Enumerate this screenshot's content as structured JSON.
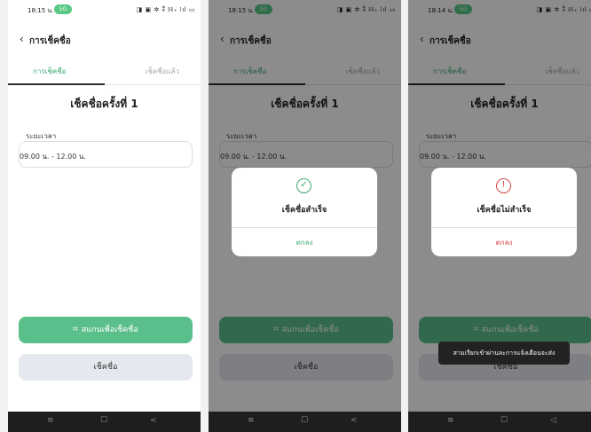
{
  "screens": [
    {
      "status": {
        "time": "18:15 น.",
        "badge": "5G",
        "sys": "◨ ▣ ✲ ⁑ ℍ₊ ⁞ıl ▭"
      },
      "title": "การเช็คชื่อ",
      "tabs": [
        {
          "label": "การเช็คชื่อ"
        },
        {
          "label": "เช็คชื่อแล้ว"
        }
      ],
      "heading": "เช็คชื่อครั้งที่ 1",
      "field_label": "ระยะเวลา",
      "field_value": "09.00 น. - 12.00 น.",
      "scan_button": "สแกนเพื่อเช็คชื่อ",
      "check_button": "เช็คชื่อ",
      "nav": [
        "≡",
        "☐",
        "<"
      ]
    },
    {
      "status": {
        "time": "18:15 น.",
        "badge": "5G",
        "sys": "◨ ▣ ✲ ⁑ ℍ₊ ⁞ıl ▭"
      },
      "title": "การเช็คชื่อ",
      "tabs": [
        {
          "label": "การเช็คชื่อ"
        },
        {
          "label": "เช็คชื่อแล้ว"
        }
      ],
      "heading": "เช็คชื่อครั้งที่ 1",
      "field_label": "ระยะเวลา",
      "field_value": "09.00 น. - 12.00 น.",
      "scan_button": "สแกนเพื่อเช็คชื่อ",
      "check_button": "เช็คชื่อ",
      "nav": [
        "≡",
        "☐",
        "<"
      ],
      "dialog": {
        "icon": "✓",
        "message": "เช็คชื่อสำเร็จ",
        "button": "ตกลง"
      }
    },
    {
      "status": {
        "time": "18:14 น.",
        "badge": "5G",
        "sys": "◨ ▣ ✲ ⁑ ℍ₊ ⁞ıl ▭"
      },
      "title": "การเช็คชื่อ",
      "tabs": [
        {
          "label": "การเช็คชื่อ"
        },
        {
          "label": "เช็คชื่อแล้ว"
        }
      ],
      "heading": "เช็คชื่อครั้งที่ 1",
      "field_label": "ระยะเวลา",
      "field_value": "09.00 น. - 12.00 น.",
      "scan_button": "สแกนเพื่อเช็คชื่อ",
      "check_button": "เช็คชื่อ",
      "nav": [
        "≡",
        "☐",
        "◁"
      ],
      "dialog": {
        "icon": "!",
        "message": "เช็คชื่อไม่สำเร็จ",
        "button": "ตกลง"
      },
      "toast": "สามเรียกเข้าผ่านละการแจ้งเตือนจะส่ง"
    }
  ],
  "colors": {
    "accent": "#3cab73",
    "scan_button": "#5bbf8b",
    "error": "#d64545",
    "secondary_button": "#e6e8ef"
  },
  "icons": {
    "back": "chevron-left-icon",
    "scan": "qr-scan-icon",
    "success": "check-circle-icon",
    "error": "alert-circle-icon"
  }
}
